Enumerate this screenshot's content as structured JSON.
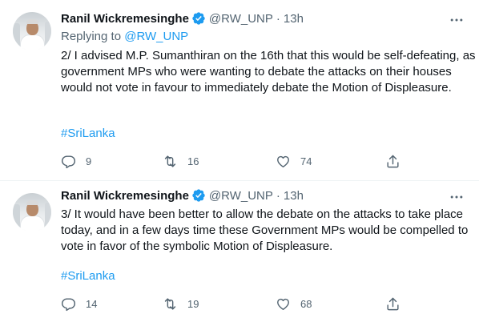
{
  "tweets": [
    {
      "author_name": "Ranil Wickremesinghe",
      "handle": "@RW_UNP",
      "separator": "·",
      "time": "13h",
      "replying_prefix": "Replying to",
      "replying_to": "@RW_UNP",
      "text": "2/ I advised M.P. Sumanthiran on the 16th that this would be self-defeating, as government MPs who were wanting to debate the attacks on their houses would not vote in favour to immediately  debate the Motion of Displeasure.",
      "hashtag": "#SriLanka",
      "replies": "9",
      "retweets": "16",
      "likes": "74"
    },
    {
      "author_name": "Ranil Wickremesinghe",
      "handle": "@RW_UNP",
      "separator": "·",
      "time": "13h",
      "text": "3/ It would have been better to allow the debate on the attacks to take place today, and in a few days time these Government MPs would be compelled to vote in favor of the symbolic Motion of Displeasure.",
      "hashtag": "#SriLanka",
      "replies": "14",
      "retweets": "19",
      "likes": "68"
    }
  ],
  "colors": {
    "accent": "#1d9bf0",
    "text_primary": "#0f1419",
    "text_secondary": "#536471",
    "divider": "#eff3f4"
  },
  "icons": [
    "verified-badge-icon",
    "more-options-icon",
    "reply-icon",
    "retweet-icon",
    "like-icon",
    "share-icon"
  ]
}
